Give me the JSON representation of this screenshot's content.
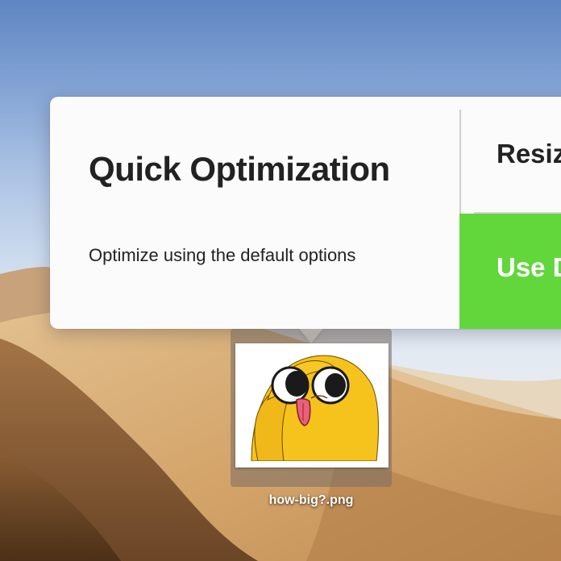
{
  "popover": {
    "quick_title": "Quick Optimization",
    "quick_description": "Optimize using the default options",
    "resize_label": "Resize",
    "use_button_label": "Use D"
  },
  "file": {
    "name": "how-big?.png"
  },
  "colors": {
    "use_button": "#62d73c",
    "popover_bg": "#fbfbfb",
    "text": "#222222"
  },
  "icons": {
    "thumbnail": "jake-the-dog-thumbnail"
  }
}
